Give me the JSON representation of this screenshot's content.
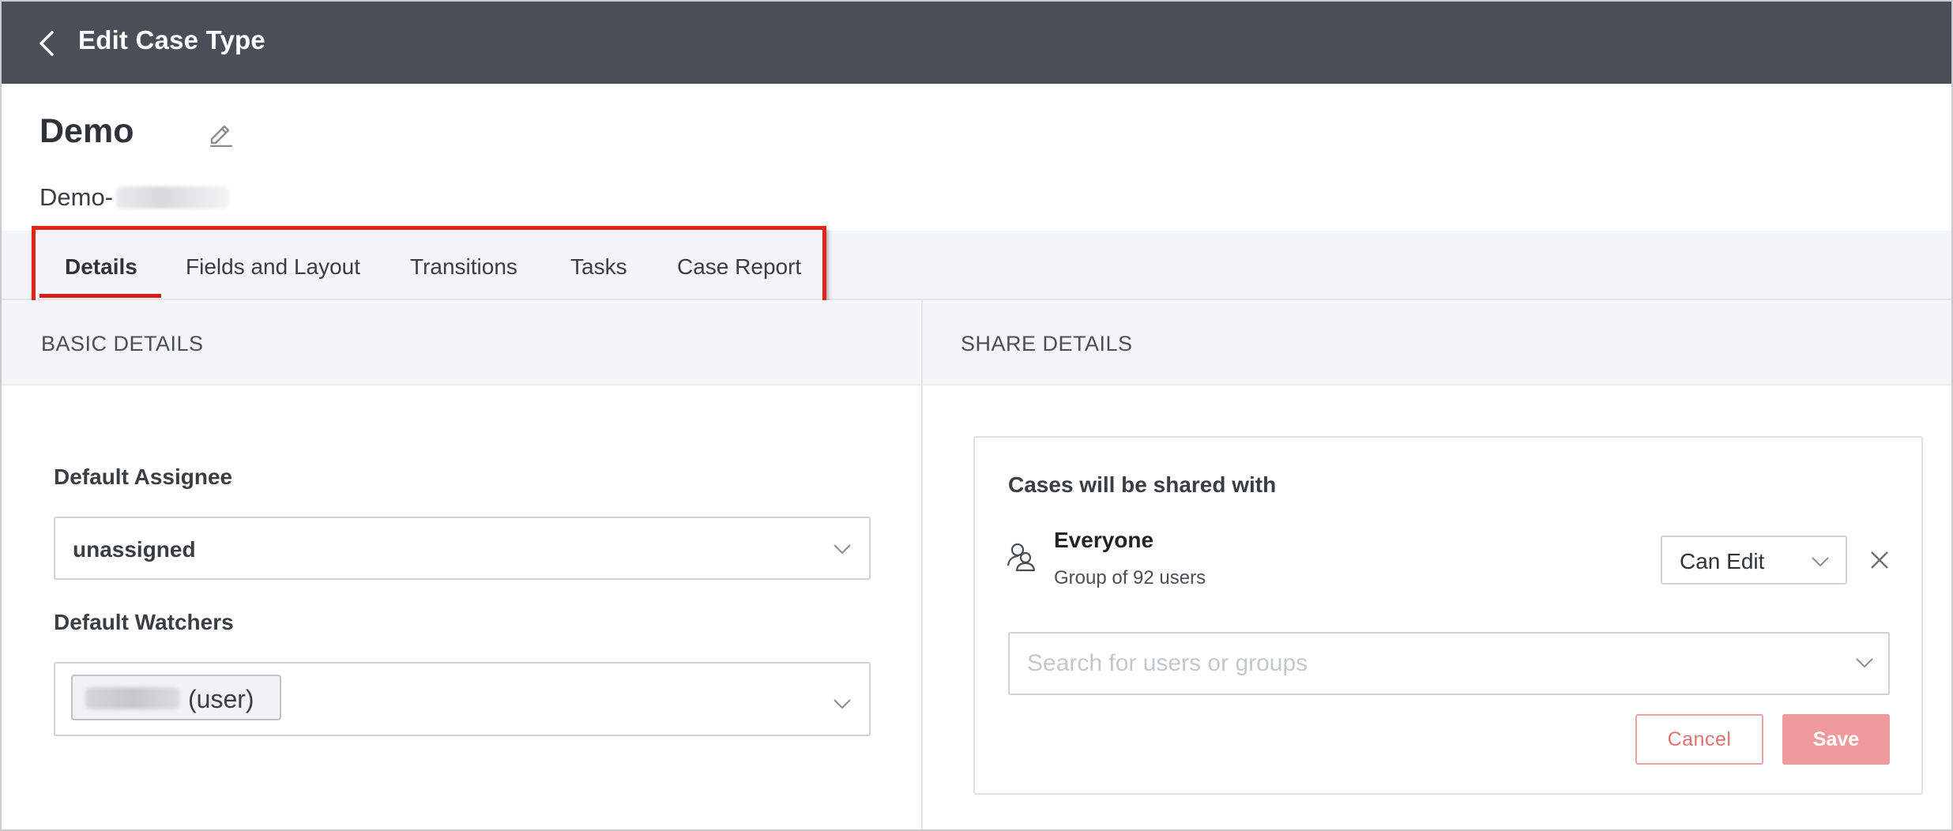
{
  "header": {
    "title": "Edit Case Type",
    "back_icon": "chevron-left-icon"
  },
  "case": {
    "name": "Demo",
    "id_prefix": "Demo-",
    "edit_icon": "pencil-icon"
  },
  "tabs": [
    {
      "label": "Details",
      "active": true
    },
    {
      "label": "Fields and Layout",
      "active": false
    },
    {
      "label": "Transitions",
      "active": false
    },
    {
      "label": "Tasks",
      "active": false
    },
    {
      "label": "Case Report",
      "active": false
    }
  ],
  "basic_details": {
    "title": "BASIC DETAILS",
    "default_assignee": {
      "label": "Default Assignee",
      "value": "unassigned"
    },
    "default_watchers": {
      "label": "Default Watchers",
      "chip_suffix": "(user)"
    }
  },
  "share_details": {
    "title": "SHARE DETAILS",
    "heading": "Cases will be shared with",
    "entry": {
      "name": "Everyone",
      "subtitle": "Group of 92 users",
      "permission": "Can Edit",
      "icon": "users-icon"
    },
    "search_placeholder": "Search for users or groups",
    "cancel_label": "Cancel",
    "save_label": "Save"
  },
  "colors": {
    "header_bg": "#4a4e56",
    "tab_active_underline": "#d51f1f",
    "highlight_border": "#e0231b",
    "save_bg": "#ef9a9a",
    "cancel_text": "#e0746d"
  }
}
